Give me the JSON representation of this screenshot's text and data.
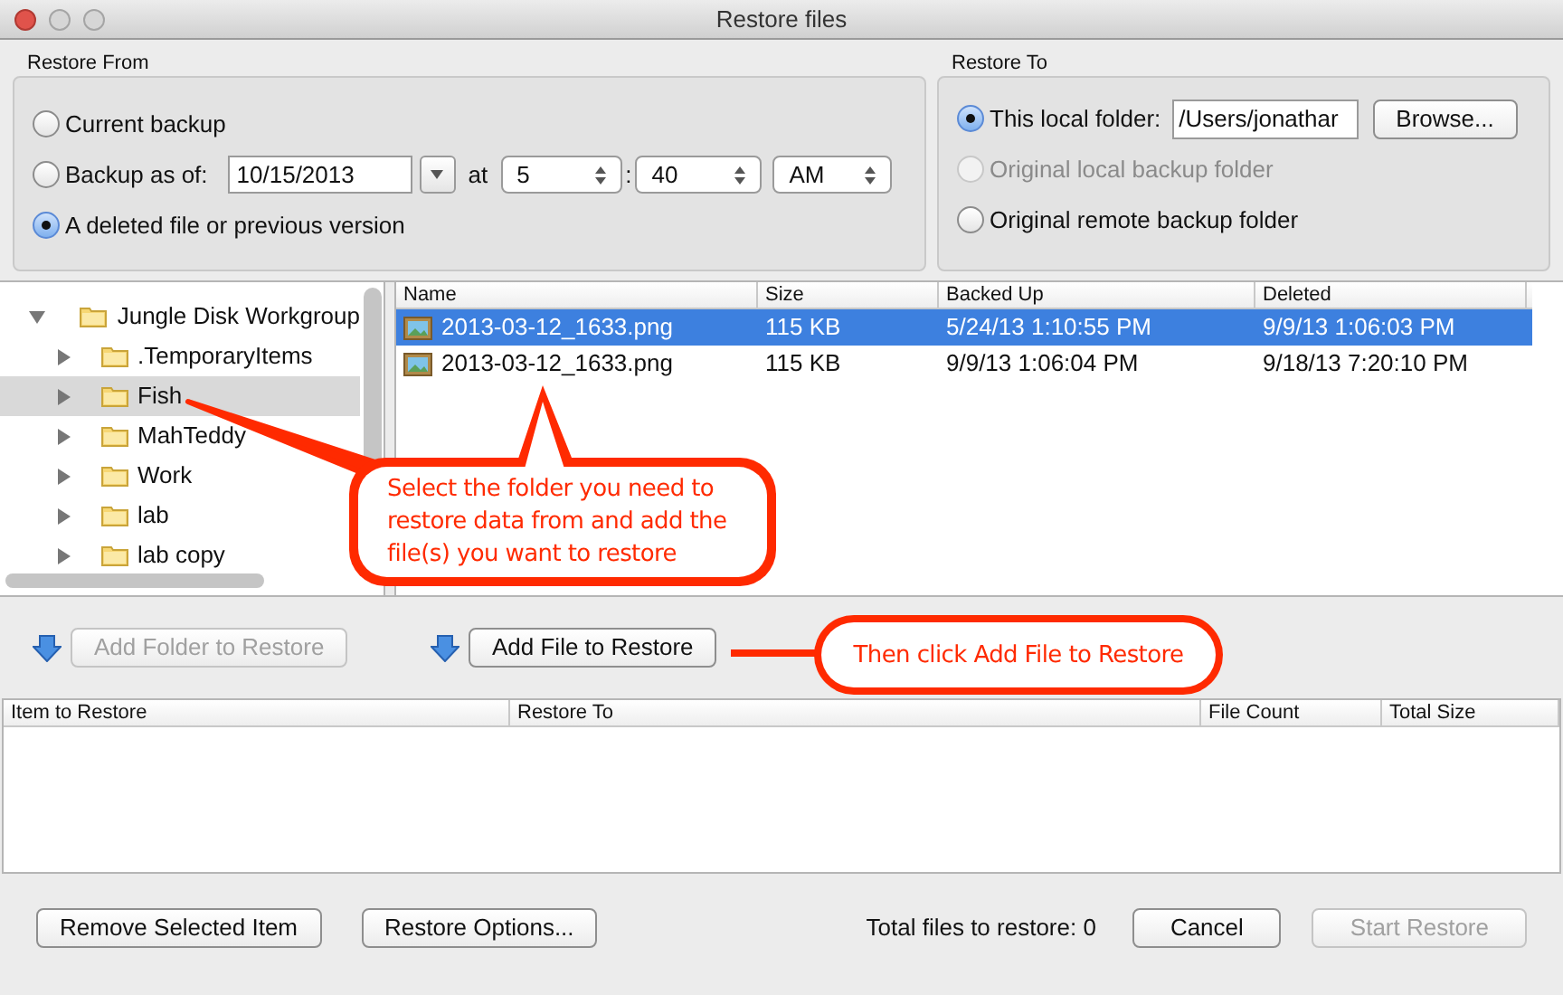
{
  "window": {
    "title": "Restore files"
  },
  "restore_from": {
    "label": "Restore From",
    "options": [
      {
        "kind": "plain",
        "label": "Current backup",
        "selected": false
      },
      {
        "kind": "date",
        "label": "Backup as of:",
        "selected": false
      },
      {
        "kind": "plain",
        "label": "A deleted file or previous version",
        "selected": true
      }
    ],
    "date": "10/15/2013",
    "at": "at",
    "hour": "5",
    "separator": ":",
    "minute": "40",
    "ampm": "AM"
  },
  "restore_to": {
    "label": "Restore To",
    "options": [
      {
        "kind": "path",
        "label": "This local folder:",
        "selected": true,
        "disabled": false
      },
      {
        "kind": "plain",
        "label": "Original local backup folder",
        "selected": false,
        "disabled": true
      },
      {
        "kind": "plain",
        "label": "Original remote backup folder",
        "selected": false,
        "disabled": false
      }
    ],
    "path": "/Users/jonathar",
    "browse": "Browse..."
  },
  "tree": {
    "label": "Jungle Disk Workgroup",
    "expanded": true,
    "children": [
      {
        "label": ".TemporaryItems",
        "expanded": false,
        "selected": false
      },
      {
        "label": "Fish",
        "expanded": false,
        "selected": true
      },
      {
        "label": "MahTeddy",
        "expanded": false,
        "selected": false
      },
      {
        "label": "Work",
        "expanded": false,
        "selected": false
      },
      {
        "label": "lab",
        "expanded": false,
        "selected": false
      },
      {
        "label": "lab copy",
        "expanded": false,
        "selected": false
      }
    ]
  },
  "files": {
    "columns": [
      "Name",
      "Size",
      "Backed Up",
      "Deleted"
    ],
    "rows": [
      {
        "cells": [
          "2013-03-12_1633.png",
          "115 KB",
          "5/24/13 1:10:55 PM",
          "9/9/13 1:06:03 PM"
        ],
        "selected": true
      },
      {
        "cells": [
          "2013-03-12_1633.png",
          "115 KB",
          "9/9/13 1:06:04 PM",
          "9/18/13 7:20:10 PM"
        ],
        "selected": false
      }
    ]
  },
  "actions": [
    {
      "label": "Add Folder to Restore",
      "disabled": true
    },
    {
      "label": "Add File to Restore",
      "disabled": false
    }
  ],
  "queue": {
    "columns": [
      "Item to Restore",
      "Restore To",
      "File Count",
      "Total Size"
    ]
  },
  "footer": {
    "left_buttons": [
      {
        "label": "Remove Selected Item",
        "disabled": false
      },
      {
        "label": "Restore Options...",
        "disabled": false
      }
    ],
    "total": "Total files to restore: 0",
    "right_buttons": [
      {
        "label": "Cancel",
        "disabled": false
      },
      {
        "label": "Start Restore",
        "disabled": true
      }
    ]
  },
  "annotations": [
    "Select the folder you need to restore data from and add the file(s) you want to restore",
    "Then click Add File to Restore"
  ]
}
